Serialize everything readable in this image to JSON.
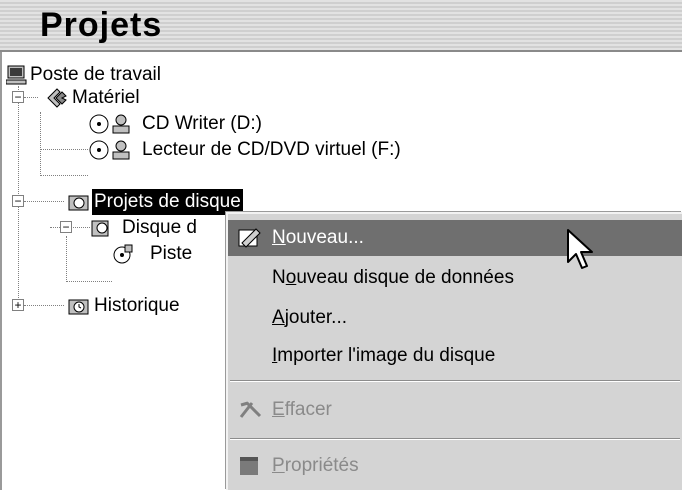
{
  "window": {
    "title": "Projets"
  },
  "tree": {
    "items": [
      {
        "label": "Poste de travail",
        "icon": "computer-icon"
      },
      {
        "label": "Matériel",
        "icon": "hardware-icon"
      },
      {
        "label": "CD Writer (D:)",
        "icon": "cd-drive-icon"
      },
      {
        "label": "Lecteur de CD/DVD virtuel (F:)",
        "icon": "virtual-drive-icon"
      },
      {
        "label": "Projets de disque",
        "icon": "disc-project-folder-icon"
      },
      {
        "label": "Disque d",
        "icon": "disc-icon"
      },
      {
        "label": "Piste",
        "icon": "track-icon"
      },
      {
        "label": "Historique",
        "icon": "history-folder-icon"
      }
    ]
  },
  "menu": {
    "items": [
      {
        "pre": "",
        "key": "N",
        "post": "ouveau...",
        "icon": "new-icon",
        "state": "highlighted"
      },
      {
        "pre": "N",
        "key": "o",
        "post": "uveau disque de données",
        "state": "normal"
      },
      {
        "pre": "",
        "key": "A",
        "post": "jouter...",
        "state": "normal"
      },
      {
        "pre": "",
        "key": "I",
        "post": "mporter l'image du disque",
        "state": "normal"
      },
      {
        "pre": "",
        "key": "E",
        "post": "ffacer",
        "icon": "delete-icon",
        "state": "disabled"
      },
      {
        "pre": "",
        "key": "P",
        "post": "ropriétés",
        "icon": "properties-icon",
        "state": "disabled"
      }
    ]
  },
  "colors": {
    "highlight": "#6f6f6f",
    "menu_bg": "#d4d4d4",
    "disabled_text": "#8a8a8a"
  }
}
